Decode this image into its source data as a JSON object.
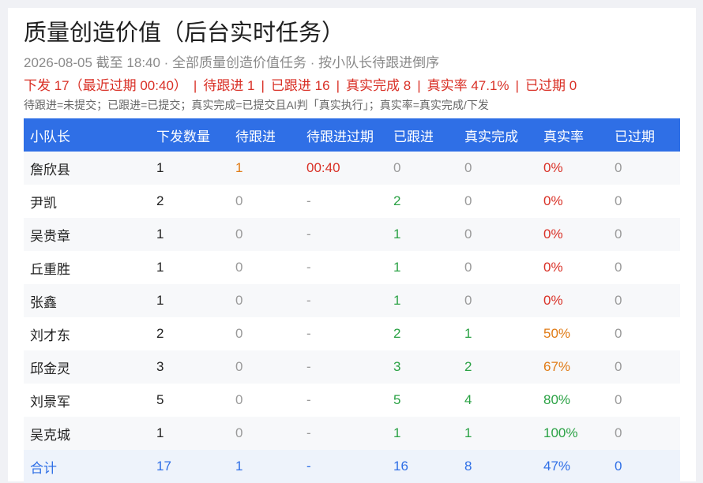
{
  "title": "质量创造价值（后台实时任务）",
  "subtitle": "2026-08-05 截至 18:40 · 全部质量创造价值任务 · 按小队长待跟进倒序",
  "summary": {
    "issued": "下发 17（最近过期 00:40）",
    "pending": "待跟进 1",
    "followed": "已跟进 16",
    "completed": "真实完成 8",
    "rate": "真实率 47.1%",
    "expired": "已过期 0",
    "separator": "|"
  },
  "legend": "待跟进=未提交；已跟进=已提交；真实完成=已提交且AI判「真实执行」；真实率=真实完成/下发",
  "table": {
    "headers": [
      "小队长",
      "下发数量",
      "待跟进",
      "待跟进过期",
      "已跟进",
      "真实完成",
      "真实率",
      "已过期"
    ],
    "rows": [
      {
        "name": "詹欣县",
        "issued": "1",
        "pending": "1",
        "pending_expire": "00:40",
        "followed": "0",
        "completed": "0",
        "rate": "0%",
        "expired": "0"
      },
      {
        "name": "尹凯",
        "issued": "2",
        "pending": "0",
        "pending_expire": "-",
        "followed": "2",
        "completed": "0",
        "rate": "0%",
        "expired": "0"
      },
      {
        "name": "吴贵章",
        "issued": "1",
        "pending": "0",
        "pending_expire": "-",
        "followed": "1",
        "completed": "0",
        "rate": "0%",
        "expired": "0"
      },
      {
        "name": "丘重胜",
        "issued": "1",
        "pending": "0",
        "pending_expire": "-",
        "followed": "1",
        "completed": "0",
        "rate": "0%",
        "expired": "0"
      },
      {
        "name": "张鑫",
        "issued": "1",
        "pending": "0",
        "pending_expire": "-",
        "followed": "1",
        "completed": "0",
        "rate": "0%",
        "expired": "0"
      },
      {
        "name": "刘才东",
        "issued": "2",
        "pending": "0",
        "pending_expire": "-",
        "followed": "2",
        "completed": "1",
        "rate": "50%",
        "expired": "0"
      },
      {
        "name": "邱金灵",
        "issued": "3",
        "pending": "0",
        "pending_expire": "-",
        "followed": "3",
        "completed": "2",
        "rate": "67%",
        "expired": "0"
      },
      {
        "name": "刘景军",
        "issued": "5",
        "pending": "0",
        "pending_expire": "-",
        "followed": "5",
        "completed": "4",
        "rate": "80%",
        "expired": "0"
      },
      {
        "name": "吴克城",
        "issued": "1",
        "pending": "0",
        "pending_expire": "-",
        "followed": "1",
        "completed": "1",
        "rate": "100%",
        "expired": "0"
      }
    ],
    "total": {
      "name": "合计",
      "issued": "17",
      "pending": "1",
      "pending_expire": "-",
      "followed": "16",
      "completed": "8",
      "rate": "47%",
      "expired": "0"
    }
  },
  "colors": {
    "header_bg": "#2f6fe6",
    "alert_red": "#d93026",
    "pending_orange": "#e07b16",
    "good_green": "#2ba245",
    "muted_gray": "#9a9a9a"
  }
}
